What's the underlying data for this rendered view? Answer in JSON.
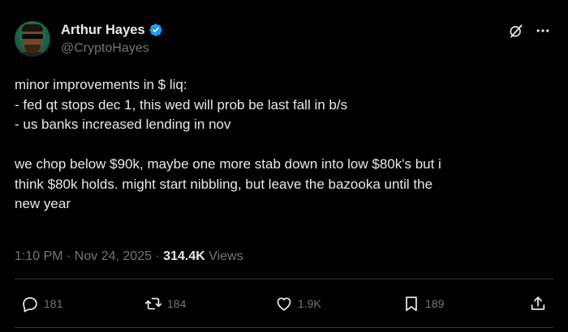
{
  "author": {
    "display_name": "Arthur Hayes",
    "handle": "@CryptoHayes",
    "verified": true,
    "verified_color": "#1d9bf0"
  },
  "tweet": {
    "lines": [
      "minor improvements in $ liq:",
      "- fed qt stops dec 1, this wed will prob be last fall in b/s",
      "- us banks increased lending in nov",
      "",
      "we chop below $90k, maybe one more stab down into low $80k's but i",
      "think $80k holds. might start nibbling, but leave the bazooka until the",
      "new year"
    ],
    "timestamp": "1:10 PM · Nov 24, 2025 · ",
    "views_count": "314.4K",
    "views_label": " Views"
  },
  "actions": {
    "replies": "181",
    "reposts": "184",
    "likes": "1.9K",
    "bookmarks": "189"
  },
  "icons": {
    "grok": "grok-icon",
    "more": "more-icon",
    "reply": "reply-icon",
    "repost": "repost-icon",
    "like": "heart-icon",
    "bookmark": "bookmark-icon",
    "share": "share-icon"
  },
  "colors": {
    "background": "#000000",
    "text": "#e7e9ea",
    "muted": "#71767b",
    "divider": "#2f3336"
  }
}
